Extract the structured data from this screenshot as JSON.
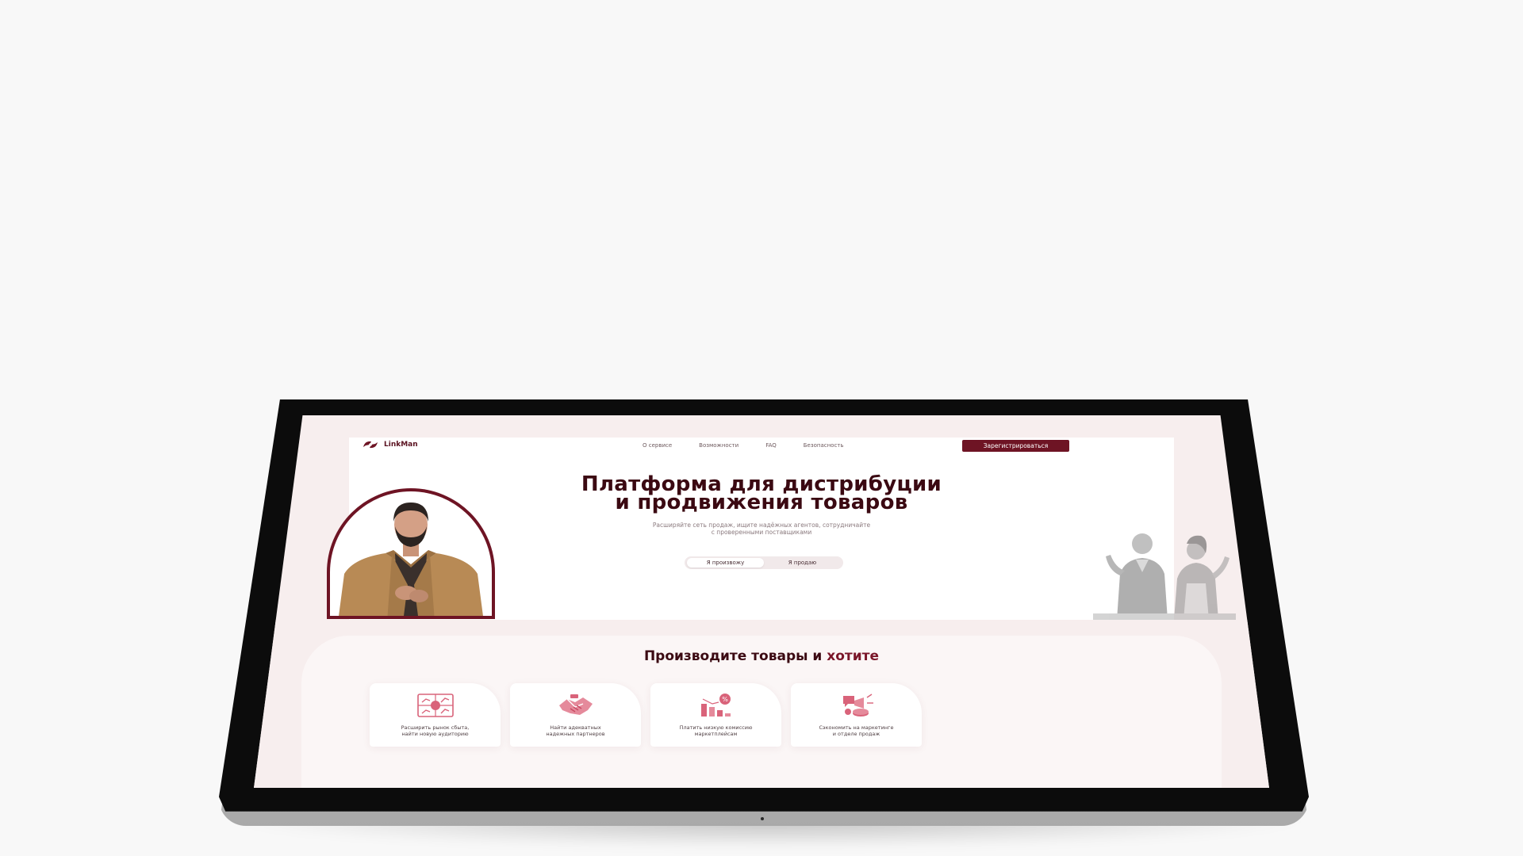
{
  "brand": {
    "name": "LinkMan"
  },
  "nav": {
    "links": [
      "О сервисе",
      "Возможности",
      "FAQ",
      "Безопасность"
    ],
    "register_label": "Зарегистрироваться"
  },
  "hero": {
    "title_line1": "Платформа для дистрибуции",
    "title_line2": "и продвижения товаров",
    "subtitle_line1": "Расширяйте сеть продаж, ищите надёжных агентов, сотрудничайте",
    "subtitle_line2": "с проверенными поставщиками",
    "toggle": {
      "options": [
        "Я произвожу",
        "Я продаю"
      ],
      "selected": "Я произвожу"
    }
  },
  "section2": {
    "title_main": "Производите товары и",
    "title_accent": "хотите",
    "cards": [
      {
        "icon": "market-expansion-icon",
        "line1": "Расширить рынок сбыта,",
        "line2": "найти новую аудиторию"
      },
      {
        "icon": "handshake-icon",
        "line1": "Найти адекватных",
        "line2": "надежных партнеров"
      },
      {
        "icon": "low-commission-icon",
        "line1": "Платить низкую комиссию",
        "line2": "маркетплейсам"
      },
      {
        "icon": "marketing-savings-icon",
        "line1": "Сэкономить на маркетинге",
        "line2": "и отделе продаж"
      }
    ]
  },
  "colors": {
    "accent": "#6e1424",
    "title": "#3b0912",
    "icon": "#d9637a",
    "screen_bg": "#f7eeee",
    "page_bg": "#f8f8f8"
  }
}
